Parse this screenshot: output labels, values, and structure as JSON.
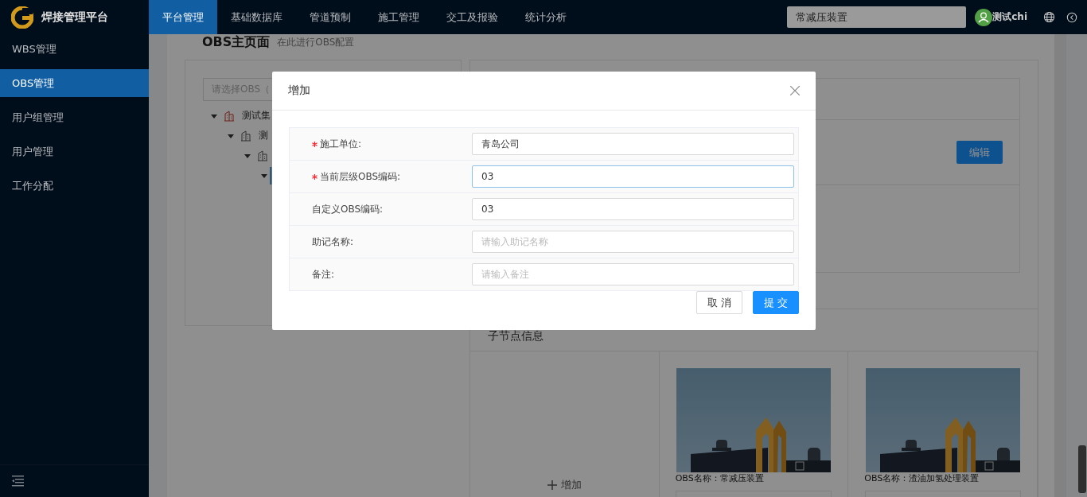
{
  "header": {
    "logo_text": "焊接管理平台",
    "nav": [
      {
        "label": "平台管理",
        "selected": true
      },
      {
        "label": "基础数据库",
        "selected": false
      },
      {
        "label": "管道预制",
        "selected": false
      },
      {
        "label": "施工管理",
        "selected": false
      },
      {
        "label": "交工及报验",
        "selected": false
      },
      {
        "label": "统计分析",
        "selected": false
      }
    ],
    "search": {
      "value": "常减压装置"
    },
    "user": {
      "name": "测试chi"
    }
  },
  "sidebar": {
    "items": [
      {
        "label": "WBS管理",
        "selected": false
      },
      {
        "label": "OBS管理",
        "selected": true
      },
      {
        "label": "用户组管理",
        "selected": false
      },
      {
        "label": "用户管理",
        "selected": false
      },
      {
        "label": "工作分配",
        "selected": false
      }
    ]
  },
  "page": {
    "title": "OBS主页面",
    "subtitle": "在此进行OBS配置"
  },
  "tree": {
    "search_placeholder": "请选择OBS（",
    "nodes": [
      {
        "label": "测试集",
        "expanded": true,
        "selected": false,
        "children": [
          {
            "label": "测",
            "expanded": true,
            "selected": false,
            "children": [
              {
                "expanded": true,
                "selected": false,
                "children": [
                  {
                    "expanded": true,
                    "selected": true
                  }
                ]
              }
            ]
          }
        ]
      }
    ]
  },
  "detail": {
    "edit_button": "编辑"
  },
  "children_section": {
    "title": "子节点信息",
    "add_label": "增加",
    "cards": [
      {
        "caption": "OBS名称：常减压装置"
      },
      {
        "caption": "OBS名称：渣油加氢处理装置"
      }
    ]
  },
  "modal": {
    "title": "增加",
    "fields": [
      {
        "label": "施工单位:",
        "required": true,
        "value": "青岛公司",
        "focused": false
      },
      {
        "label": "当前层级OBS编码:",
        "required": true,
        "value": "03",
        "focused": true
      },
      {
        "label": "自定义OBS编码:",
        "required": false,
        "value": "03",
        "focused": false
      },
      {
        "label": "助记名称:",
        "required": false,
        "placeholder": "请输入助记名称",
        "focused": false
      },
      {
        "label": "备注:",
        "required": false,
        "placeholder": "请输入备注",
        "focused": false
      }
    ],
    "cancel_button": "取 消",
    "submit_button": "提 交"
  }
}
